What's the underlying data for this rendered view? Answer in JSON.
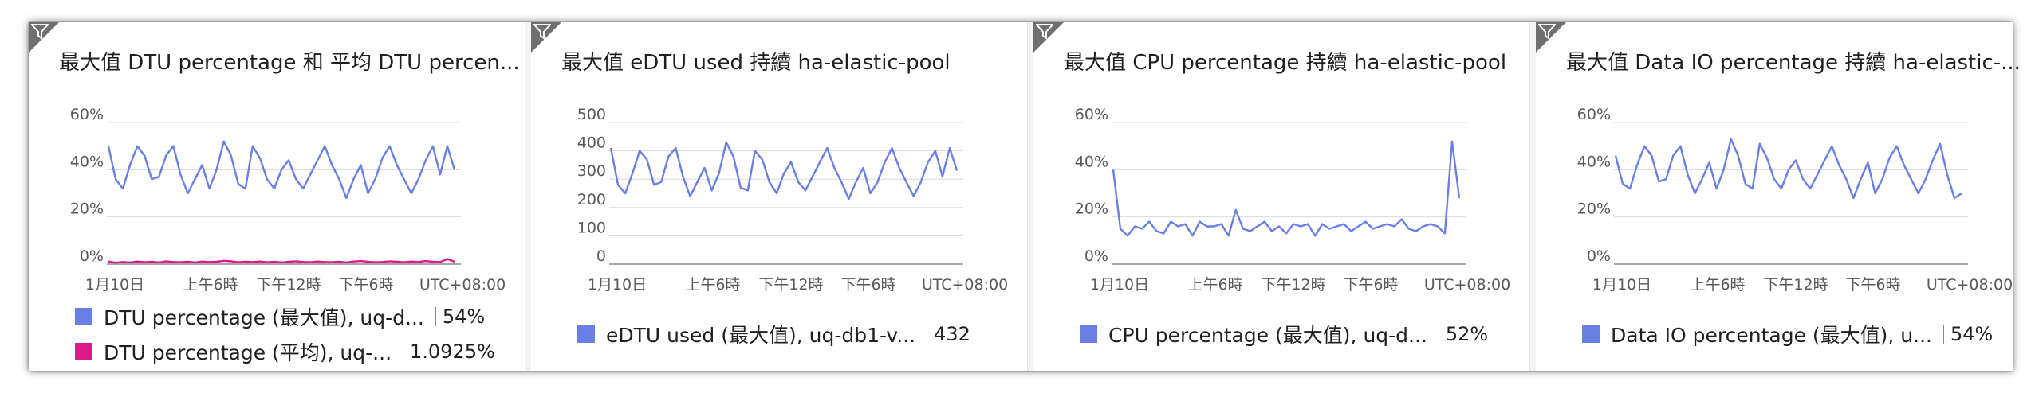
{
  "colors": {
    "primary": "#6a7fe3",
    "secondary": "#e0198a",
    "grid": "#d9d9d9",
    "axis": "#8a8a8a"
  },
  "tiles": [
    {
      "title": "最大值 DTU percentage 和 平均 DTU percen...",
      "yticks": [
        "60%",
        "40%",
        "20%",
        "0%"
      ],
      "xticks": [
        "1月10日",
        "上午6時",
        "下午12時",
        "下午6時",
        "UTC+08:00"
      ],
      "legend": [
        {
          "label": "DTU percentage (最大值), uq-d...",
          "value": "54%"
        },
        {
          "label": "DTU percentage (平均), uq-...",
          "value": "1.0925%"
        }
      ]
    },
    {
      "title": "最大值 eDTU used 持續 ha-elastic-pool",
      "yticks": [
        "500",
        "400",
        "300",
        "200",
        "100",
        "0"
      ],
      "xticks": [
        "1月10日",
        "上午6時",
        "下午12時",
        "下午6時",
        "UTC+08:00"
      ],
      "legend": [
        {
          "label": "eDTU used (最大值), uq-db1-v...",
          "value": "432"
        }
      ]
    },
    {
      "title": "最大值 CPU percentage 持續 ha-elastic-pool",
      "yticks": [
        "60%",
        "40%",
        "20%",
        "0%"
      ],
      "xticks": [
        "1月10日",
        "上午6時",
        "下午12時",
        "下午6時",
        "UTC+08:00"
      ],
      "legend": [
        {
          "label": "CPU percentage (最大值), uq-d...",
          "value": "52%"
        }
      ]
    },
    {
      "title": "最大值 Data IO percentage 持續 ha-elastic-...",
      "yticks": [
        "60%",
        "40%",
        "20%",
        "0%"
      ],
      "xticks": [
        "1月10日",
        "上午6時",
        "下午12時",
        "下午6時",
        "UTC+08:00"
      ],
      "legend": [
        {
          "label": "Data IO percentage (最大值), u...",
          "value": "54%"
        }
      ]
    }
  ],
  "chart_data": [
    {
      "type": "line",
      "ylim": [
        0,
        60
      ],
      "yticks": [
        60,
        40,
        20,
        0
      ],
      "series": [
        {
          "name": "DTU percentage (最大值)",
          "color": "#6a7fe3",
          "values": [
            50,
            36,
            32,
            42,
            50,
            46,
            36,
            37,
            46,
            50,
            38,
            30,
            36,
            42,
            32,
            40,
            52,
            46,
            34,
            32,
            50,
            45,
            36,
            32,
            40,
            44,
            36,
            32,
            38,
            44,
            50,
            42,
            36,
            28,
            36,
            42,
            30,
            36,
            45,
            50,
            42,
            36,
            30,
            36,
            44,
            50,
            38,
            50,
            40
          ]
        },
        {
          "name": "DTU percentage (平均)",
          "color": "#e0198a",
          "values": [
            1.1,
            0.6,
            0.9,
            0.7,
            1.1,
            0.8,
            1.0,
            0.7,
            1.2,
            0.9,
            0.8,
            1.0,
            0.7,
            1.1,
            0.9,
            1.0,
            1.4,
            1.2,
            0.8,
            1.0,
            0.9,
            1.1,
            0.8,
            1.0,
            0.7,
            1.0,
            1.2,
            0.9,
            0.8,
            1.1,
            0.9,
            0.8,
            1.0,
            0.7,
            1.1,
            1.3,
            1.0,
            0.8,
            0.9,
            1.2,
            1.0,
            0.8,
            1.1,
            0.9,
            1.3,
            1.0,
            0.9,
            2.2,
            1.0
          ]
        }
      ]
    },
    {
      "type": "line",
      "ylim": [
        0,
        500
      ],
      "yticks": [
        500,
        400,
        300,
        200,
        100,
        0
      ],
      "series": [
        {
          "name": "eDTU used (最大值)",
          "color": "#6a7fe3",
          "values": [
            410,
            280,
            250,
            320,
            400,
            370,
            280,
            290,
            380,
            410,
            310,
            240,
            290,
            340,
            260,
            320,
            430,
            380,
            270,
            260,
            400,
            370,
            290,
            250,
            320,
            360,
            290,
            260,
            310,
            360,
            410,
            340,
            290,
            230,
            290,
            340,
            250,
            290,
            360,
            410,
            340,
            290,
            240,
            290,
            360,
            400,
            310,
            410,
            330
          ]
        }
      ]
    },
    {
      "type": "line",
      "ylim": [
        0,
        60
      ],
      "yticks": [
        60,
        40,
        20,
        0
      ],
      "series": [
        {
          "name": "CPU percentage (最大值)",
          "color": "#6a7fe3",
          "values": [
            40,
            15,
            12,
            16,
            15,
            18,
            14,
            13,
            18,
            16,
            17,
            12,
            18,
            16,
            16,
            17,
            12,
            23,
            15,
            14,
            16,
            18,
            14,
            16,
            13,
            17,
            16,
            17,
            12,
            17,
            15,
            16,
            17,
            14,
            16,
            18,
            15,
            16,
            17,
            16,
            19,
            15,
            14,
            16,
            17,
            16,
            13,
            52,
            28
          ]
        }
      ]
    },
    {
      "type": "line",
      "ylim": [
        0,
        60
      ],
      "yticks": [
        60,
        40,
        20,
        0
      ],
      "series": [
        {
          "name": "Data IO percentage (最大值)",
          "color": "#6a7fe3",
          "values": [
            46,
            34,
            32,
            42,
            50,
            46,
            35,
            36,
            46,
            50,
            38,
            30,
            36,
            43,
            32,
            40,
            53,
            46,
            34,
            32,
            51,
            45,
            36,
            32,
            40,
            44,
            36,
            32,
            38,
            44,
            50,
            42,
            36,
            28,
            36,
            43,
            30,
            36,
            45,
            50,
            42,
            36,
            30,
            36,
            44,
            51,
            38,
            28,
            30
          ]
        }
      ]
    }
  ]
}
